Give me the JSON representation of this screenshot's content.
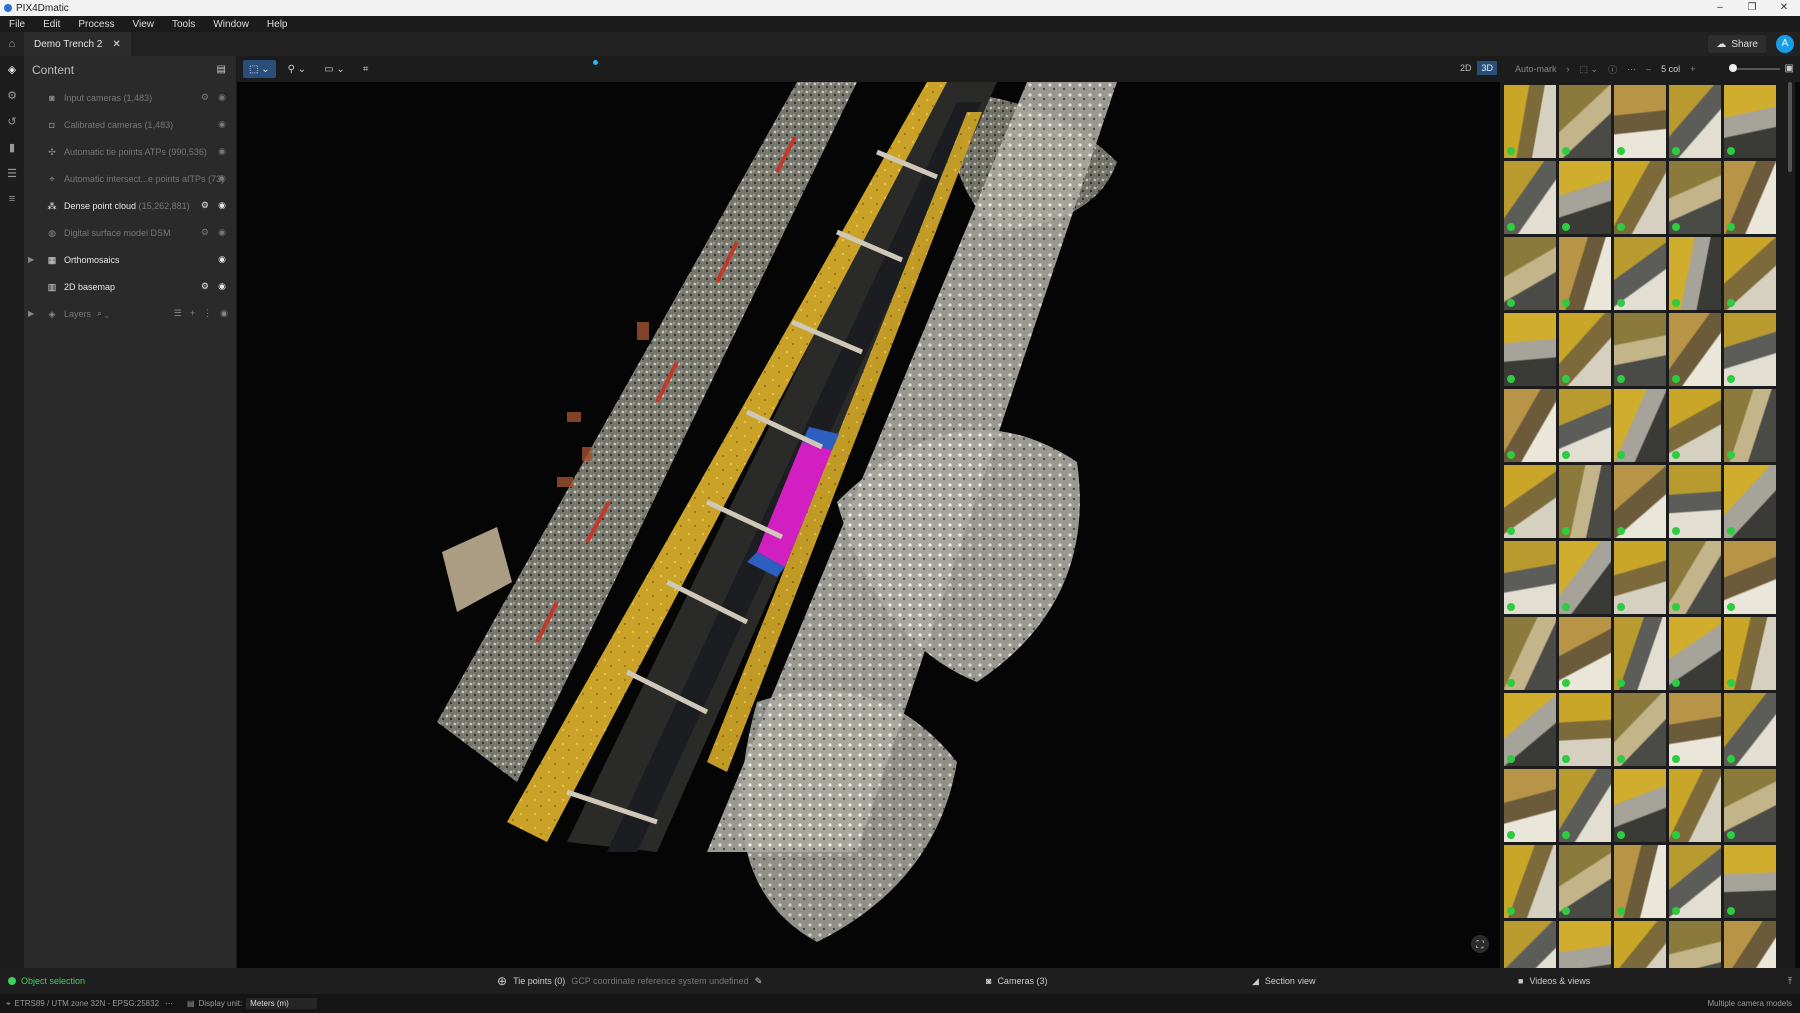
{
  "app": {
    "title": "PIX4Dmatic",
    "window_controls": [
      "–",
      "❐",
      "✕"
    ]
  },
  "menu": [
    "File",
    "Edit",
    "Process",
    "View",
    "Tools",
    "Window",
    "Help"
  ],
  "tab": {
    "name": "Demo Trench 2",
    "close": "✕"
  },
  "header": {
    "share_label": "Share",
    "avatar_letter": "A"
  },
  "panel": {
    "title": "Content",
    "items": [
      {
        "label": "Input cameras",
        "count": "(1,483)",
        "icon": "camera-icon",
        "active": false,
        "expandable": false,
        "gear": true
      },
      {
        "label": "Calibrated cameras",
        "count": "(1,483)",
        "icon": "calibrated-camera-icon",
        "active": false,
        "expandable": false,
        "gear": false
      },
      {
        "label": "Automatic tie points ATPs",
        "count": "(990,536)",
        "icon": "tie-points-icon",
        "active": false,
        "expandable": false,
        "gear": false
      },
      {
        "label": "Automatic intersect...e points aITPs",
        "count": "(73)",
        "icon": "intersection-points-icon",
        "active": false,
        "expandable": false,
        "gear": false
      },
      {
        "label": "Dense point cloud",
        "count": "(15,262,881)",
        "icon": "point-cloud-icon",
        "active": true,
        "expandable": false,
        "gear": true
      },
      {
        "label": "Digital surface model DSM",
        "count": "",
        "icon": "dsm-icon",
        "active": false,
        "expandable": false,
        "gear": true
      },
      {
        "label": "Orthomosaics",
        "count": "",
        "icon": "orthomosaic-icon",
        "active": true,
        "expandable": true,
        "gear": false
      },
      {
        "label": "2D basemap",
        "count": "",
        "icon": "basemap-icon",
        "active": true,
        "expandable": false,
        "gear": true
      }
    ],
    "layers_label": "Layers"
  },
  "viewbar": {
    "mode_2d": "2D",
    "mode_3d": "3D"
  },
  "gallerybar": {
    "automark": "Auto-mark",
    "columns": "5 col",
    "minus": "–",
    "plus": "+"
  },
  "status": {
    "selection": "Object selection",
    "tie_points": "Tie points (0)",
    "gcp_note": "GCP coordinate reference system undefined",
    "cameras": "Cameras (3)",
    "section": "Section view",
    "videos": "Videos & views"
  },
  "footer": {
    "crs": "ETRS89 / UTM zone 32N - EPSG:25832",
    "display_unit_label": "Display unit:",
    "display_unit_value": "Meters (m)",
    "camera_models": "Multiple camera models"
  },
  "colors": {
    "accent": "#2a4e7a",
    "ok": "#2ecc40",
    "avatar": "#1a9be6",
    "pipe_magenta": "#d21fc1",
    "shoring_yellow": "#d8b12a"
  }
}
